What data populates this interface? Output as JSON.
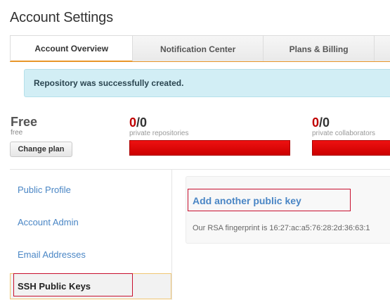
{
  "page": {
    "title": "Account Settings"
  },
  "tabs": [
    {
      "label": "Account Overview",
      "active": true
    },
    {
      "label": "Notification Center",
      "active": false
    },
    {
      "label": "Plans & Billing",
      "active": false
    },
    {
      "label": "",
      "active": false
    }
  ],
  "flash": {
    "message": "Repository was successfully created."
  },
  "plan": {
    "name": "Free",
    "sub": "free",
    "change_label": "Change plan"
  },
  "usage": [
    {
      "used": "0",
      "total": "/0",
      "label": "private repositories",
      "fill": 1.0
    },
    {
      "used": "0",
      "total": "/0",
      "label": "private collaborators",
      "fill": 1.0
    }
  ],
  "sidebar": {
    "items": [
      {
        "label": "Public Profile",
        "selected": false
      },
      {
        "label": "Account Admin",
        "selected": false
      },
      {
        "label": "Email Addresses",
        "selected": false
      },
      {
        "label": "SSH Public Keys",
        "selected": true
      }
    ]
  },
  "keys": {
    "add_label": "Add another public key",
    "fingerprint": "Our RSA fingerprint is 16:27:ac:a5:76:28:2d:36:63:1"
  },
  "colors": {
    "accent": "#e8962a",
    "link": "#4a86c5",
    "flash_bg": "#d2eef5",
    "usage_bar": "#cc0000",
    "annotation": "#c8102e"
  }
}
